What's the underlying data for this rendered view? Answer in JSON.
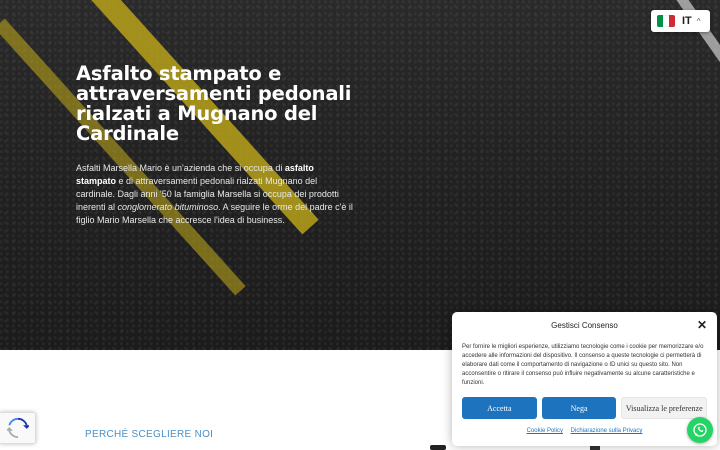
{
  "hero": {
    "title": "Asfalto stampato e attraversamenti pedonali rialzati a Mugnano del Cardinale",
    "text_part1": "Asfalti Marsella Mario è un'azienda che si occupa di ",
    "text_bold1": "asfalto stampato",
    "text_part2": " e di attraversamenti pedonali rialzati Mugnano del cardinale. Dagli anni '50 la famiglia Marsella si occupa dei prodotti inerenti al ",
    "text_italic": "conglomerato bituminoso",
    "text_part3": ". A seguire le orme del padre c'è il figlio Mario Marsella che accresce l'idea di business."
  },
  "language": {
    "code": "IT",
    "flag_colors": [
      "#009246",
      "#ffffff",
      "#ce2b37"
    ],
    "icon": "chevron-up-icon"
  },
  "section": {
    "why_title": "PERCHÉ SCEGLIERE NOI"
  },
  "consent": {
    "title": "Gestisci Consenso",
    "text": "Per fornire le migliori esperienze, utilizziamo tecnologie come i cookie per memorizzare e/o accedere alle informazioni del dispositivo. Il consenso a queste tecnologie ci permetterà di elaborare dati come il comportamento di navigazione o ID unici su questo sito. Non acconsentire o ritirare il consenso può influire negativamente su alcune caratteristiche e funzioni.",
    "accept_label": "Accetta",
    "deny_label": "Nega",
    "prefs_label": "Visualizza le preferenze",
    "cookie_policy_label": "Cookie Policy",
    "privacy_label": "Dichiarazione sulla Privacy"
  },
  "colors": {
    "accent_blue": "#1e73be",
    "whatsapp_green": "#25d366",
    "section_title": "#4a8fc8"
  }
}
